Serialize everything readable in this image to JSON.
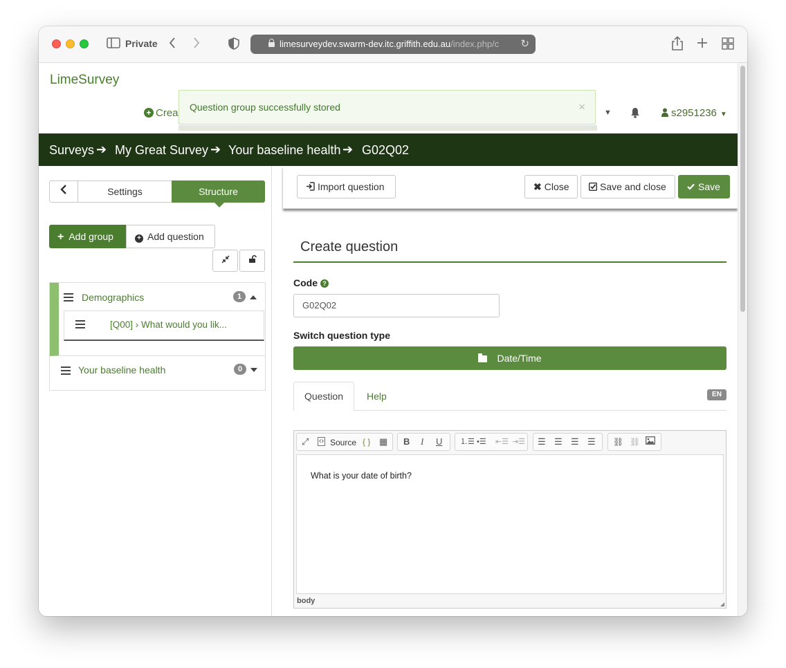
{
  "browser": {
    "private_label": "Private",
    "url_main": "limesurveydev.swarm-dev.itc.griffith.edu.au",
    "url_faded": "/index.php/c"
  },
  "header": {
    "brand": "LimeSurvey",
    "create_link": "Creat",
    "user": "s2951236"
  },
  "alert": {
    "message": "Question group successfully stored",
    "close": "×"
  },
  "breadcrumb": {
    "items": [
      "Surveys",
      "My Great Survey",
      "Your baseline health",
      "G02Q02"
    ]
  },
  "sidebar": {
    "tabs": {
      "settings": "Settings",
      "structure": "Structure"
    },
    "add_group": "Add group",
    "add_question": "Add question",
    "groups": [
      {
        "name": "Demographics",
        "count": "1",
        "questions": [
          "[Q00] › What would you lik..."
        ]
      },
      {
        "name": "Your baseline health",
        "count": "0"
      }
    ]
  },
  "actions": {
    "import": "Import question",
    "close": "Close",
    "save_close": "Save and close",
    "save": "Save"
  },
  "form": {
    "heading": "Create question",
    "code_label": "Code",
    "code_value": "G02Q02",
    "switch_label": "Switch question type",
    "question_type": "Date/Time",
    "tabs": [
      "Question",
      "Help"
    ],
    "language": "EN"
  },
  "editor": {
    "source_label": "Source",
    "content": "What is your date of birth?",
    "path": "body"
  },
  "colors": {
    "brand_green": "#4a7d2e",
    "button_green": "#5b8b3e",
    "breadcrumb_bg": "#1e3614",
    "alert_bg": "#f3f9ee"
  }
}
